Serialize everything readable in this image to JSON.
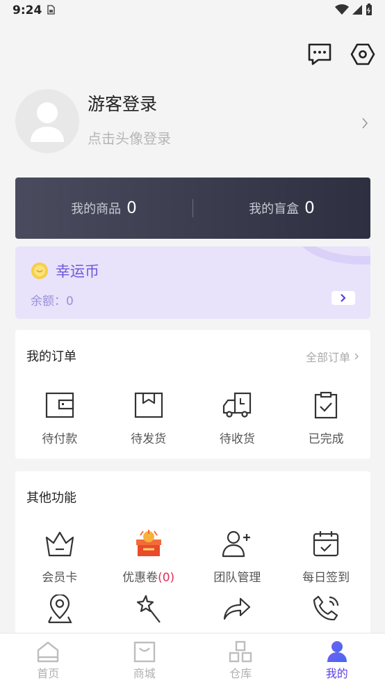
{
  "status_bar": {
    "time": "9:24"
  },
  "profile": {
    "name": "游客登录",
    "hint": "点击头像登录"
  },
  "stats": [
    {
      "label": "我的商品",
      "value": "0"
    },
    {
      "label": "我的盲盒",
      "value": "0"
    }
  ],
  "lucky_coin": {
    "title": "幸运币",
    "balance": "余额：0"
  },
  "orders": {
    "title": "我的订单",
    "all_label": "全部订单",
    "items": [
      {
        "label": "待付款",
        "icon": "wallet-icon"
      },
      {
        "label": "待发货",
        "icon": "package-icon"
      },
      {
        "label": "待收货",
        "icon": "truck-icon"
      },
      {
        "label": "已完成",
        "icon": "clipboard-check-icon"
      }
    ]
  },
  "features": {
    "title": "其他功能",
    "row1": [
      {
        "label": "会员卡",
        "icon": "crown-icon"
      },
      {
        "label": "优惠卷",
        "count": "(0)",
        "icon": "gift-box-icon"
      },
      {
        "label": "团队管理",
        "icon": "add-user-icon"
      },
      {
        "label": "每日签到",
        "icon": "calendar-check-icon"
      }
    ],
    "row2_icons": [
      "map-pin-icon",
      "magic-wand-icon",
      "share-arrow-icon",
      "phone-icon"
    ]
  },
  "tabs": [
    {
      "label": "首页",
      "icon": "home-icon"
    },
    {
      "label": "商城",
      "icon": "shopping-bag-icon"
    },
    {
      "label": "仓库",
      "icon": "warehouse-icon"
    },
    {
      "label": "我的",
      "icon": "user-icon",
      "active": true
    }
  ],
  "colors": {
    "accent": "#5b3ee6",
    "coin_title": "#7254dd",
    "coupon_count": "#e0305a"
  }
}
